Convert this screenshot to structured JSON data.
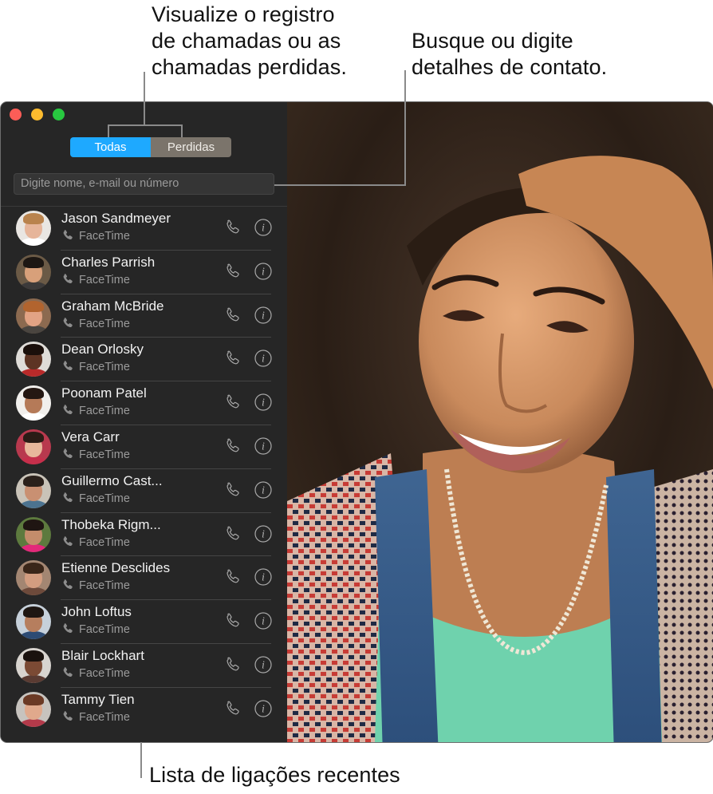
{
  "callouts": {
    "view_log": [
      "Visualize o registro",
      "de chamadas ou as",
      "chamadas perdidas."
    ],
    "search": [
      "Busque ou digite",
      "detalhes de contato."
    ],
    "recent_list": "Lista de ligações recentes"
  },
  "window": {
    "traffic_lights": [
      "close",
      "minimize",
      "zoom"
    ]
  },
  "segmented_control": {
    "options": [
      "Todas",
      "Perdidas"
    ],
    "selected": "Todas",
    "colors": {
      "selected": "#1ea9ff",
      "unselected": "#7b746b"
    }
  },
  "search": {
    "placeholder": "Digite nome, e-mail ou número",
    "value": ""
  },
  "recents": [
    {
      "name": "Jason Sandmeyer",
      "type": "FaceTime",
      "skin": "#e6b59a",
      "hair": "#b9834d",
      "shirt": "#ffffff",
      "bg": "#e9e6e2"
    },
    {
      "name": "Charles Parrish",
      "type": "FaceTime",
      "skin": "#d8a07a",
      "hair": "#1d1713",
      "shirt": "#3c3a3a",
      "bg": "#6b5a46"
    },
    {
      "name": "Graham McBride",
      "type": "FaceTime",
      "skin": "#e2a384",
      "hair": "#b2642e",
      "shirt": "#4a4540",
      "bg": "#8c6a50"
    },
    {
      "name": "Dean Orlosky",
      "type": "FaceTime",
      "skin": "#5d3424",
      "hair": "#1a0f0b",
      "shirt": "#b92a2a",
      "bg": "#dfdcd8"
    },
    {
      "name": "Poonam Patel",
      "type": "FaceTime",
      "skin": "#b57a58",
      "hair": "#241712",
      "shirt": "#ffffff",
      "bg": "#f1efec"
    },
    {
      "name": "Vera Carr",
      "type": "FaceTime",
      "skin": "#e8b79b",
      "hair": "#2a1c16",
      "shirt": "#c62f4b",
      "bg": "#b8394e"
    },
    {
      "name": "Guillermo Cast...",
      "type": "FaceTime",
      "skin": "#c99072",
      "hair": "#2b211b",
      "shirt": "#4c7390",
      "bg": "#c9c3b8"
    },
    {
      "name": "Thobeka Rigm...",
      "type": "FaceTime",
      "skin": "#c48c6b",
      "hair": "#1f1512",
      "shirt": "#e3287a",
      "bg": "#5d7a3e"
    },
    {
      "name": "Etienne Desclides",
      "type": "FaceTime",
      "skin": "#d39d80",
      "hair": "#3a2619",
      "shirt": "#6d4a3b",
      "bg": "#a38672"
    },
    {
      "name": "John Loftus",
      "type": "FaceTime",
      "skin": "#b67e5e",
      "hair": "#1d1612",
      "shirt": "#2d4b74",
      "bg": "#c6d0da"
    },
    {
      "name": "Blair Lockhart",
      "type": "FaceTime",
      "skin": "#7b4a34",
      "hair": "#1a120e",
      "shirt": "#5a3b32",
      "bg": "#d8d4cf"
    },
    {
      "name": "Tammy Tien",
      "type": "FaceTime",
      "skin": "#e0a98c",
      "hair": "#6b3a25",
      "shirt": "#b33a4a",
      "bg": "#c7c3be"
    }
  ],
  "video": {
    "description": "smiling woman with curly hair, teal shirt, denim overalls"
  }
}
